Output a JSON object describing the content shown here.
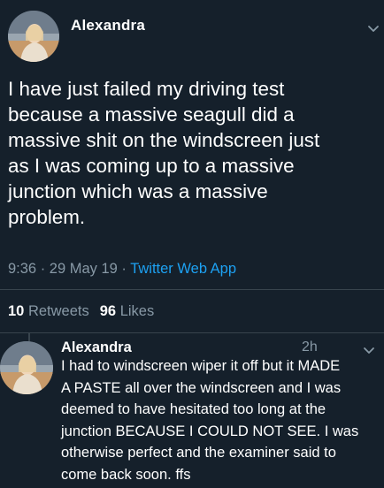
{
  "tweet": {
    "author_name": "Alexandra",
    "text": "I have just failed my driving test\nbecause a massive seagull did a\nmassive shit on the windscreen just\nas I was coming up to a massive\njunction which was a massive\nproblem.",
    "time_date": "9:36 · 29 May 19 · ",
    "app": "Twitter Web App",
    "retweets_count": "10",
    "retweets_label": "Retweets",
    "likes_count": "96",
    "likes_label": "Likes"
  },
  "reply": {
    "author_name": "Alexandra",
    "time": "2h",
    "text": "I had to windscreen wiper it off but it MADE\nA PASTE all over the windscreen and I was\ndeemed to have hesitated too long at the\njunction BECAUSE I COULD NOT SEE. I was\notherwise perfect and the examiner said to\ncome back soon. ffs"
  },
  "icons": {
    "menu": "chevron-down-icon",
    "avatar": "avatar-photo"
  },
  "colors": {
    "background": "#15202b",
    "text_primary": "#ffffff",
    "text_secondary": "#8899a6",
    "link": "#1da1f2",
    "divider": "#38444d"
  }
}
